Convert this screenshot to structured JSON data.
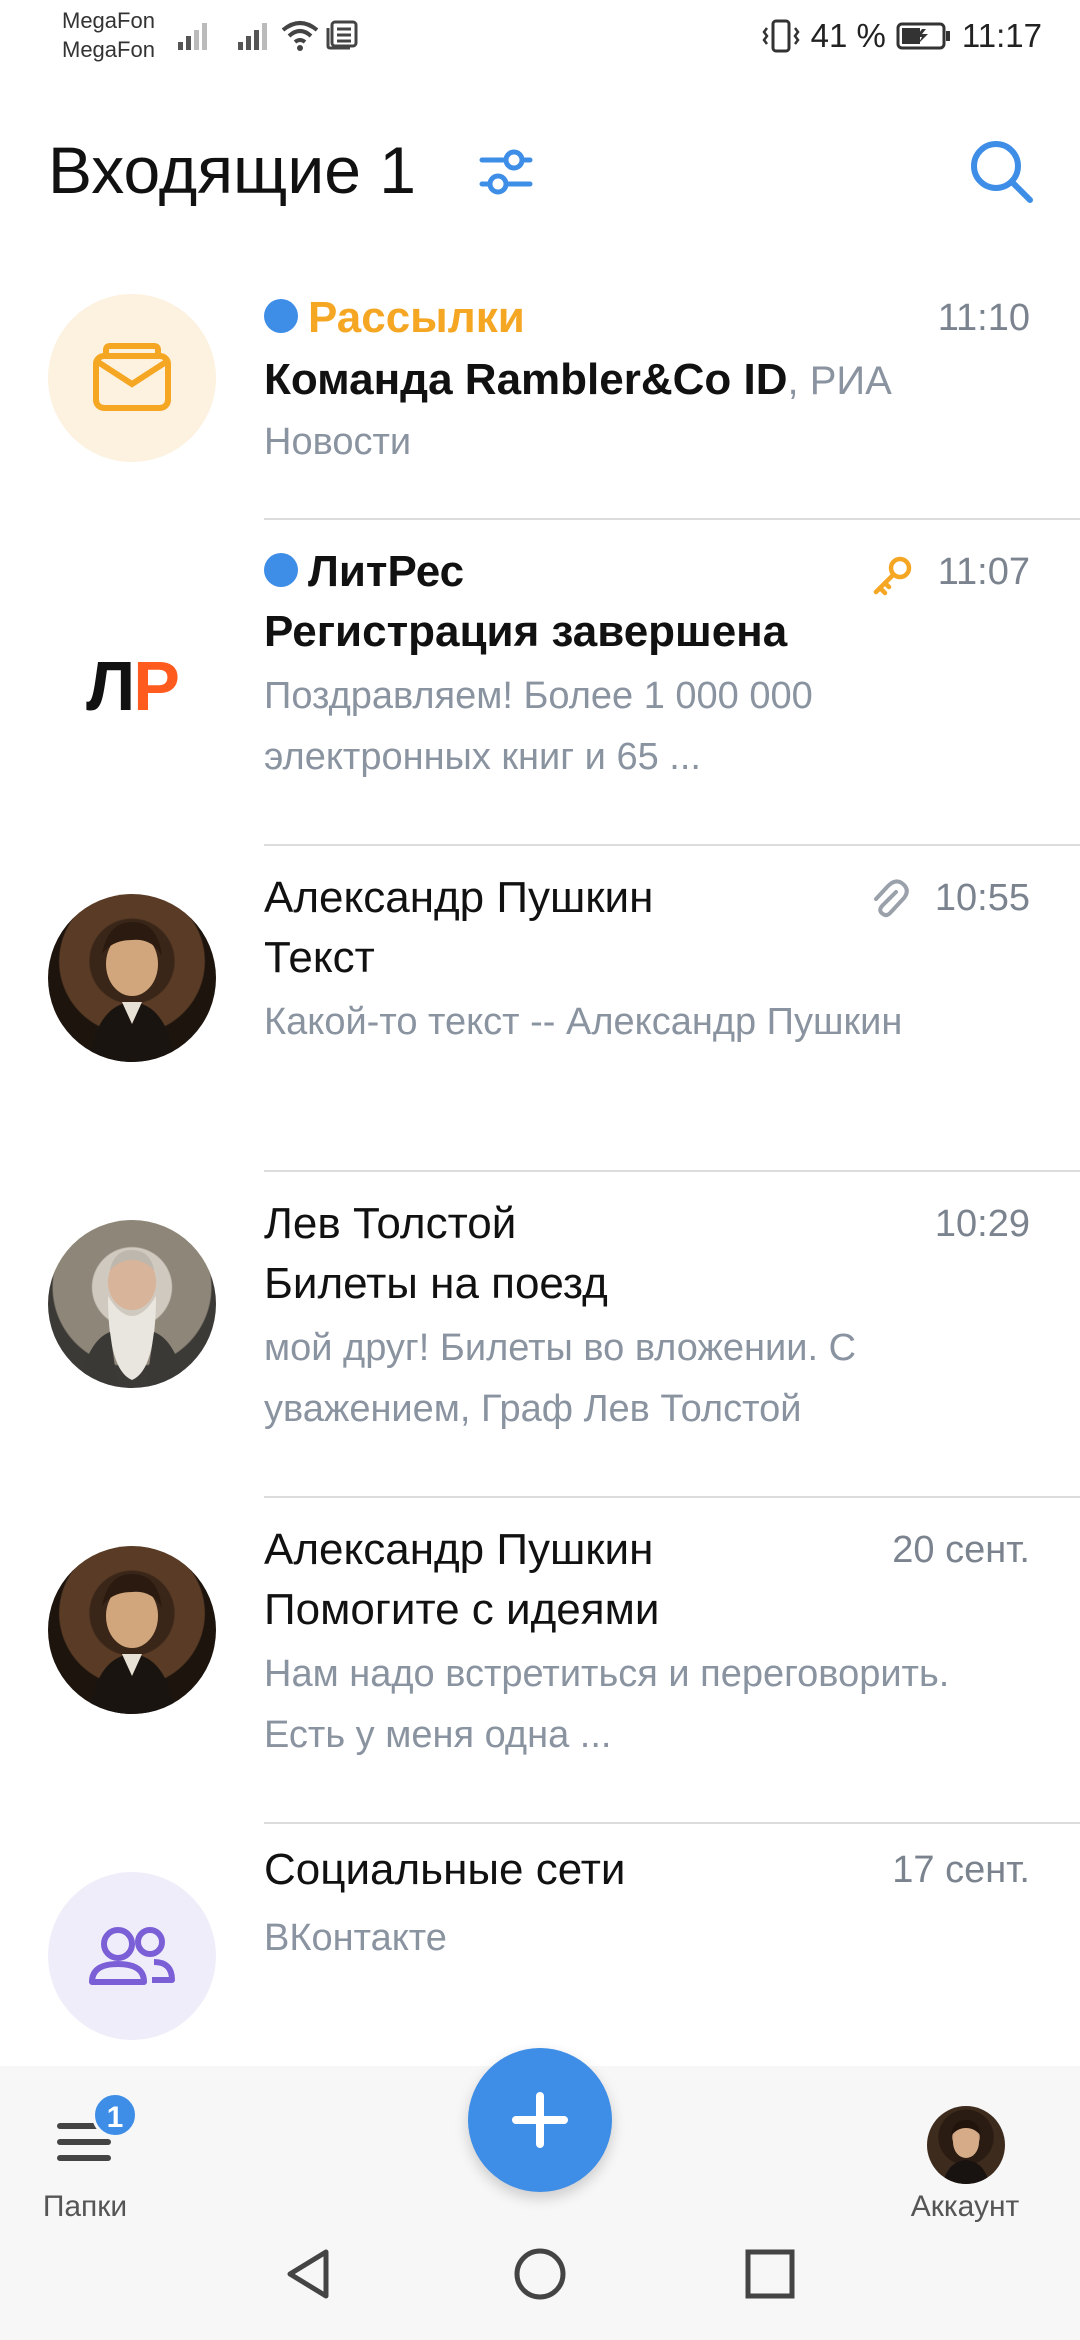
{
  "status_bar": {
    "carrier_1": "MegaFon",
    "carrier_2": "MegaFon",
    "battery": "41 %",
    "time": "11:17"
  },
  "header": {
    "title": "Входящие 1",
    "filter_icon": "sliders-icon",
    "search_icon": "search-icon",
    "accent_color": "#3e8de6"
  },
  "messages": [
    {
      "sender": "Рассылки",
      "sender_color": "#f5a623",
      "unread": true,
      "time": "11:10",
      "line2_bold": "Команда Rambler&Co ID",
      "line2_rest": ", РИА",
      "line3": "Новости",
      "avatar": "mail-icon"
    },
    {
      "sender": "ЛитРес",
      "unread": true,
      "time": "11:07",
      "subject": "Регистрация завершена",
      "preview": "Поздравляем! Более 1 000 000 электронных книг и 65 ...",
      "avatar_logo": "ЛР",
      "meta_icon": "key-icon"
    },
    {
      "sender": "Александр Пушкин",
      "unread": false,
      "time": "10:55",
      "subject": "Текст",
      "preview": "Какой-то текст -- Александр Пушкин",
      "meta_icon": "paperclip-icon"
    },
    {
      "sender": "Лев Толстой",
      "unread": false,
      "time": "10:29",
      "subject": "Билеты на поезд",
      "preview": "мой друг! Билеты во вложении. С уважением, Граф Лев Толстой"
    },
    {
      "sender": "Александр Пушкин",
      "unread": false,
      "time": "20 сент.",
      "subject": "Помогите с идеями",
      "preview": "Нам надо встретиться и переговорить. Есть у меня одна ..."
    },
    {
      "sender": "Социальные сети",
      "sender_color": "#7b5fd6",
      "unread": false,
      "time": "17 сент.",
      "preview": "ВКонтакте",
      "avatar": "people-icon"
    }
  ],
  "bottom_bar": {
    "folders_label": "Папки",
    "folders_badge": "1",
    "compose_icon": "plus-icon",
    "account_label": "Аккаунт"
  },
  "nav_bar": {
    "back_icon": "triangle-back-icon",
    "home_icon": "circle-home-icon",
    "recents_icon": "square-recents-icon"
  }
}
